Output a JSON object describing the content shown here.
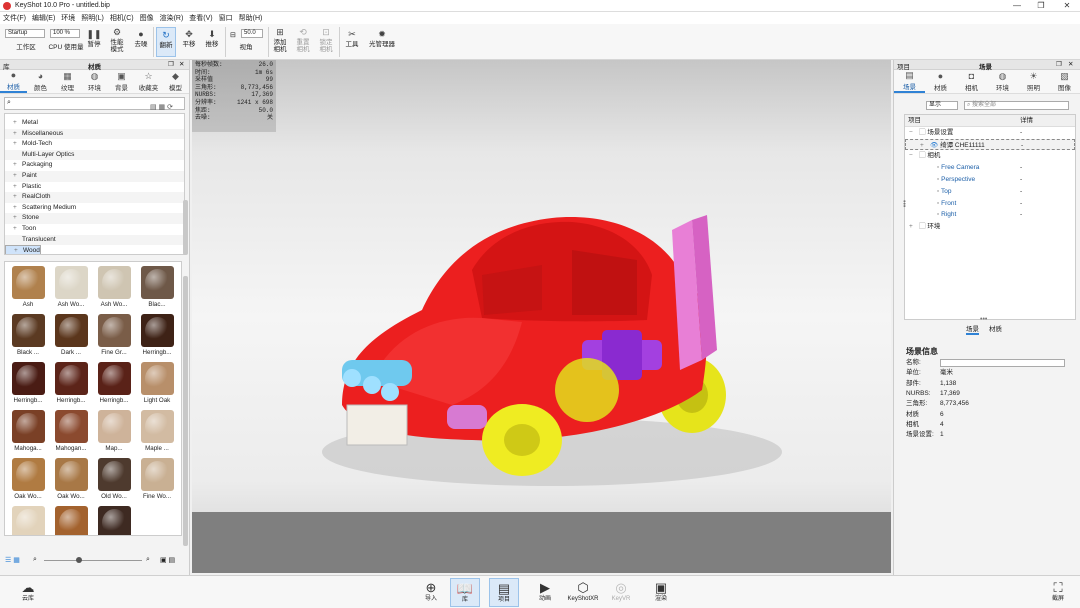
{
  "app": {
    "title": "KeyShot 10.0 Pro  - untitled.bip"
  },
  "window_controls": {
    "minimize": "—",
    "maximize": "❐",
    "close": "✕"
  },
  "menu": [
    "文件(F)",
    "编辑(E)",
    "环境",
    "照明(L)",
    "相机(C)",
    "图像",
    "渲染(R)",
    "查看(V)",
    "窗口",
    "帮助(H)"
  ],
  "toolbar": {
    "workspace_select": "Startup",
    "workspace_label": "工作区",
    "cpu_select": "100 %",
    "cpu_label": "CPU 使用量",
    "pause_label": "暂停",
    "perf_label": "性能\n模式",
    "denoise_label": "去噪",
    "refresh_label": "翻新",
    "pan_label": "平移",
    "push_label": "推移",
    "fov_value": "50.0",
    "fov_label": "视角",
    "add_camera_label": "添加\n相机",
    "reset_camera_label": "重置\n相机",
    "lock_camera_label": "锁定\n相机",
    "tools_label": "工具",
    "light_manager_label": "光管理器"
  },
  "left_panel": {
    "header_left": "库",
    "header_title": "材质",
    "tabs": [
      {
        "icon": "material-icon",
        "label": "材质"
      },
      {
        "icon": "color-icon",
        "label": "颜色"
      },
      {
        "icon": "texture-icon",
        "label": "纹理"
      },
      {
        "icon": "environment-icon",
        "label": "环境"
      },
      {
        "icon": "background-icon",
        "label": "背景"
      },
      {
        "icon": "favorites-icon",
        "label": "收藏夹"
      },
      {
        "icon": "model-icon",
        "label": "模型"
      }
    ],
    "tree": [
      {
        "label": "Metal",
        "expand": true
      },
      {
        "label": "Miscellaneous",
        "expand": true
      },
      {
        "label": "Mold-Tech",
        "expand": true
      },
      {
        "label": "Multi-Layer Optics",
        "expand": false
      },
      {
        "label": "Packaging",
        "expand": true
      },
      {
        "label": "Paint",
        "expand": true
      },
      {
        "label": "Plastic",
        "expand": true
      },
      {
        "label": "RealCloth",
        "expand": true
      },
      {
        "label": "Scattering Medium",
        "expand": true
      },
      {
        "label": "Stone",
        "expand": true
      },
      {
        "label": "Toon",
        "expand": true
      },
      {
        "label": "Translucent",
        "expand": false
      },
      {
        "label": "Wood",
        "expand": true
      }
    ],
    "thumbnails": [
      {
        "label": "Ash",
        "color": "#b0814d"
      },
      {
        "label": "Ash Wo...",
        "color": "#dcd6c7"
      },
      {
        "label": "Ash Wo...",
        "color": "#cfc5b2"
      },
      {
        "label": "Blac...",
        "color": "#6e5848"
      },
      {
        "label": "Black ...",
        "color": "#5b3a22"
      },
      {
        "label": "Dark ...",
        "color": "#5b361c"
      },
      {
        "label": "Fine Gr...",
        "color": "#7a5d48"
      },
      {
        "label": "Herringb...",
        "color": "#3e2216"
      },
      {
        "label": "Herringb...",
        "color": "#4a1c14"
      },
      {
        "label": "Herringb...",
        "color": "#5c2419"
      },
      {
        "label": "Herringb...",
        "color": "#5a2218"
      },
      {
        "label": "Light Oak",
        "color": "#b88f6a"
      },
      {
        "label": "Mahoga...",
        "color": "#7a4026"
      },
      {
        "label": "Mahogan...",
        "color": "#8b4a2f"
      },
      {
        "label": "Map...",
        "color": "#ceb39a"
      },
      {
        "label": "Maple ...",
        "color": "#d2bba2"
      },
      {
        "label": "Oak Wo...",
        "color": "#b07b42"
      },
      {
        "label": "Oak Wo...",
        "color": "#a87846"
      },
      {
        "label": "Old Wo...",
        "color": "#4e3a2e"
      },
      {
        "label": "Fine Wo...",
        "color": "#c9b093"
      },
      {
        "label": "",
        "color": "#e2d3bb"
      },
      {
        "label": "",
        "color": "#a3622e"
      },
      {
        "label": "",
        "color": "#3e2a22"
      }
    ]
  },
  "viewport": {
    "stats": [
      {
        "k": "每秒帧数:",
        "v": "26.0"
      },
      {
        "k": "时间:",
        "v": "1m 6s"
      },
      {
        "k": "采样值",
        "v": "99"
      },
      {
        "k": "三角形:",
        "v": "8,773,456"
      },
      {
        "k": "NURBS:",
        "v": "17,369"
      },
      {
        "k": "分辨率:",
        "v": "1241 x 698"
      },
      {
        "k": "焦距:",
        "v": "50.0"
      },
      {
        "k": "去噪:",
        "v": "关"
      }
    ]
  },
  "right_panel": {
    "header_left": "项目",
    "header_title": "场景",
    "tabs": [
      {
        "icon": "scene-icon",
        "label": "场景"
      },
      {
        "icon": "material-icon",
        "label": "材质"
      },
      {
        "icon": "camera-icon",
        "label": "相机"
      },
      {
        "icon": "environment-icon",
        "label": "环境"
      },
      {
        "icon": "lighting-icon",
        "label": "照明"
      },
      {
        "icon": "image-icon",
        "label": "图像"
      }
    ],
    "filter_select": "显示",
    "search_placeholder": "搜索全部",
    "columns": [
      "项目",
      "详情"
    ],
    "tree": [
      {
        "label": "场景设置",
        "detail": "-",
        "indent": 1,
        "expand": "−"
      },
      {
        "label": "绮谭 CHE11111",
        "detail": "-",
        "indent": 2,
        "expand": "+"
      },
      {
        "label": "相机",
        "detail": "",
        "indent": 1,
        "expand": "−"
      },
      {
        "label": "Free Camera",
        "detail": "-",
        "indent": 3,
        "expand": ""
      },
      {
        "label": "Perspective",
        "detail": "-",
        "indent": 3,
        "expand": ""
      },
      {
        "label": "Top",
        "detail": "-",
        "indent": 3,
        "expand": ""
      },
      {
        "label": "Front",
        "detail": "-",
        "indent": 3,
        "expand": ""
      },
      {
        "label": "Right",
        "detail": "-",
        "indent": 3,
        "expand": ""
      },
      {
        "label": "环境",
        "detail": "",
        "indent": 1,
        "expand": "+"
      }
    ],
    "bottom_tabs": [
      "场景",
      "材质"
    ],
    "info_title": "场景信息",
    "info": [
      {
        "k": "名称:",
        "v": ""
      },
      {
        "k": "单位:",
        "v": "毫米"
      },
      {
        "k": "部件:",
        "v": "1,138"
      },
      {
        "k": "NURBS:",
        "v": "17,369"
      },
      {
        "k": "三角形:",
        "v": "8,773,456"
      },
      {
        "k": "材质",
        "v": "6"
      },
      {
        "k": "相机",
        "v": "4"
      },
      {
        "k": "场景设置:",
        "v": "1"
      }
    ]
  },
  "bottom": {
    "cloud_label": "云库",
    "buttons": [
      {
        "icon": "import-icon",
        "label": "导入"
      },
      {
        "icon": "library-icon",
        "label": "库"
      },
      {
        "icon": "project-icon",
        "label": "项目"
      },
      {
        "icon": "animation-icon",
        "label": "动画"
      },
      {
        "icon": "keyshotxr-icon",
        "label": "KeyShotXR"
      },
      {
        "icon": "keyvr-icon",
        "label": "KeyVR"
      },
      {
        "icon": "render-icon",
        "label": "渲染"
      }
    ],
    "screenshot_label": "截屏"
  }
}
